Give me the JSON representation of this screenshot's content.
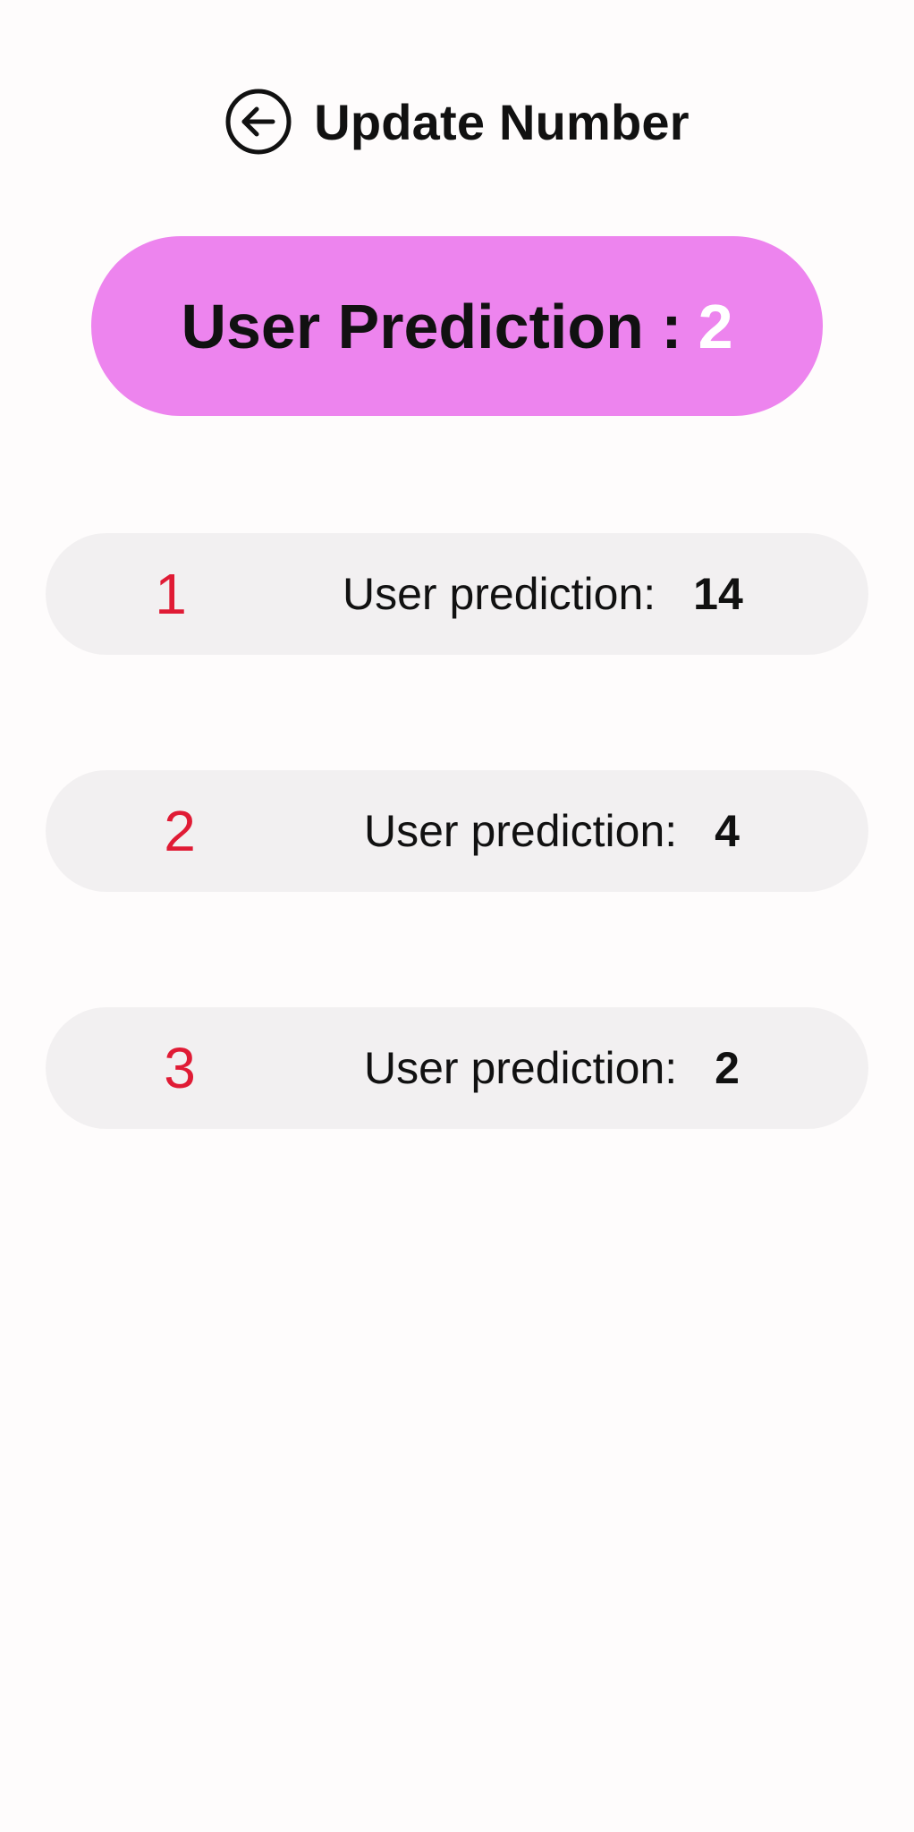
{
  "header": {
    "back_icon": "arrow-left-circle-icon",
    "title": "Update Number"
  },
  "summary": {
    "label": "User Prediction :",
    "value": "2",
    "background_color": "#ed84ee"
  },
  "predictions": [
    {
      "index": "1",
      "label": "User prediction:",
      "value": "14"
    },
    {
      "index": "2",
      "label": "User prediction:",
      "value": "4"
    },
    {
      "index": "3",
      "label": "User prediction:",
      "value": "2"
    }
  ],
  "colors": {
    "index_color": "#e01b35",
    "row_background": "#f2f0f1"
  }
}
